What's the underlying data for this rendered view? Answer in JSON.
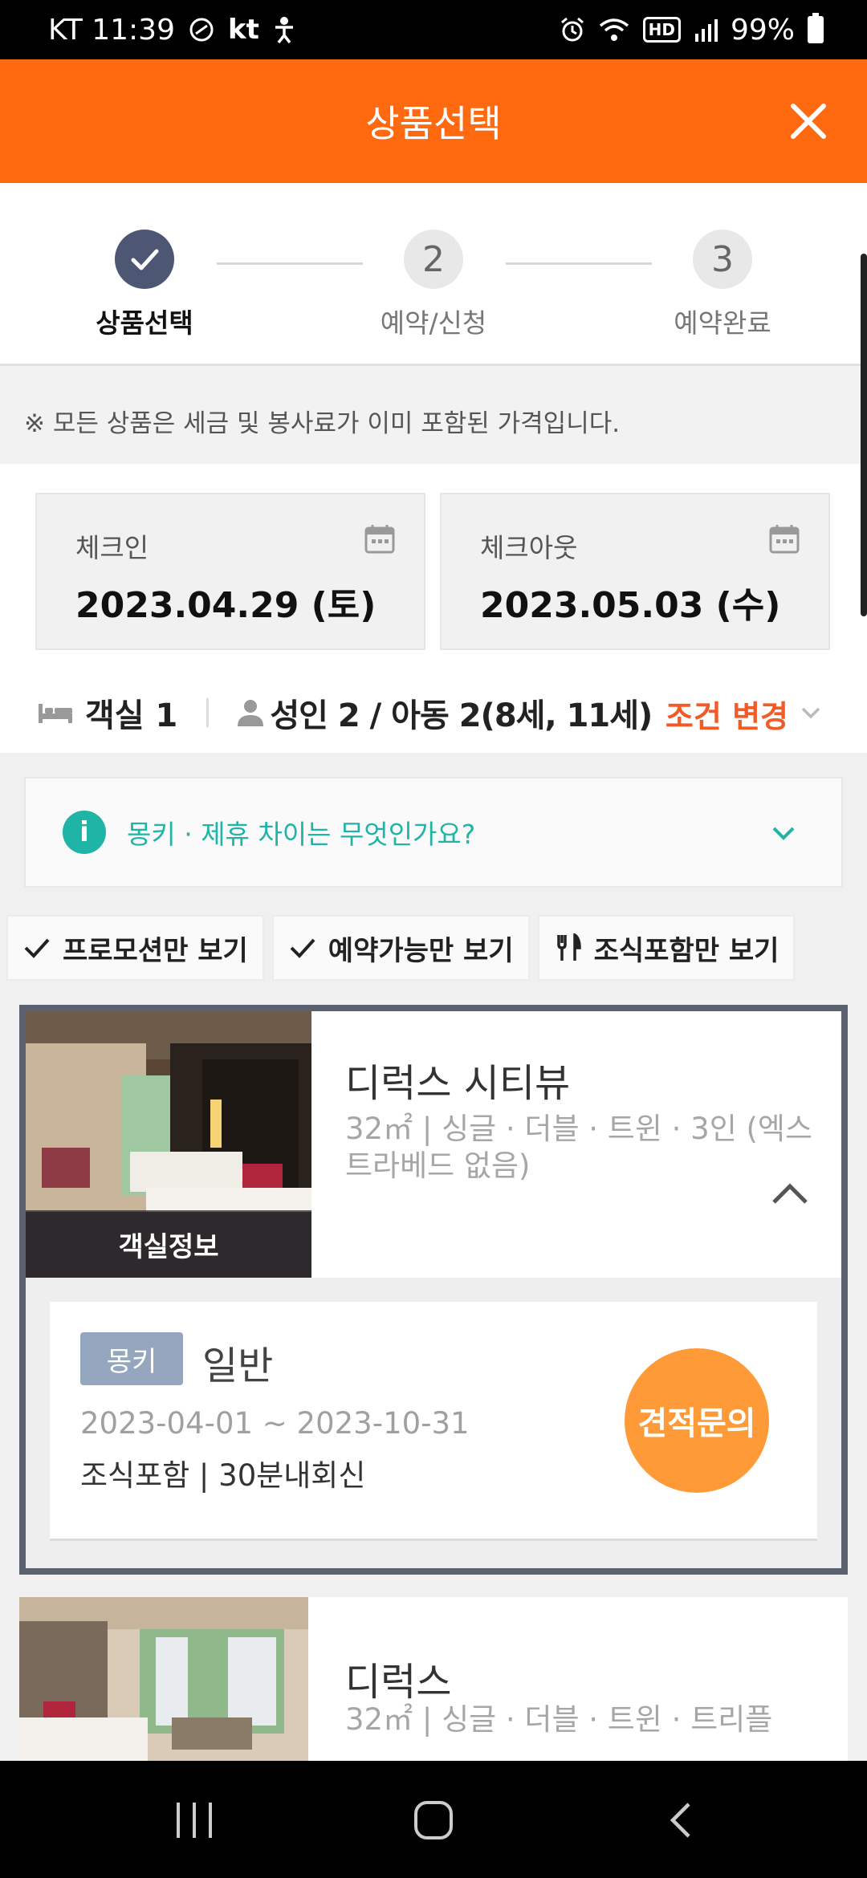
{
  "status_bar": {
    "carrier_time": "KT 11:39",
    "carrier_logo": "kt",
    "battery": "99%",
    "hd_label": "HD",
    "icons": [
      "nfc-icon",
      "kt-logo",
      "accessibility-icon",
      "alarm-icon",
      "wifi-icon",
      "hd-voice-icon",
      "signal-icon",
      "battery-icon"
    ]
  },
  "header": {
    "title": "상품선택",
    "close_icon": "close-icon"
  },
  "steps": [
    {
      "number": "1",
      "label": "상품선택",
      "state": "done"
    },
    {
      "number": "2",
      "label": "예약/신청",
      "state": "pending"
    },
    {
      "number": "3",
      "label": "예약완료",
      "state": "pending"
    }
  ],
  "notice": "※ 모든 상품은 세금 및 봉사료가 이미 포함된 가격입니다.",
  "checkin": {
    "label": "체크인",
    "value": "2023.04.29 (토)"
  },
  "checkout": {
    "label": "체크아웃",
    "value": "2023.05.03 (수)"
  },
  "condition": {
    "rooms": "객실 1",
    "guests": "성인 2 / 아동 2(8세, 11세)",
    "change_label": "조건 변경"
  },
  "faq": {
    "info_icon": "i",
    "text": "몽키 · 제휴 차이는 무엇인가요?"
  },
  "filters": [
    {
      "label": "프로모션만 보기",
      "icon": "check-icon"
    },
    {
      "label": "예약가능만 보기",
      "icon": "check-icon"
    },
    {
      "label": "조식포함만 보기",
      "icon": "utensils-icon"
    }
  ],
  "rooms": [
    {
      "name": "디럭스 시티뷰",
      "spec": "32㎡ | 싱글 · 더블 · 트윈 · 3인 (엑스트라베드 없음)",
      "image_caption": "객실정보",
      "rate": {
        "badge": "몽키",
        "name": "일반",
        "period": "2023-04-01 ~ 2023-10-31",
        "conditions": "조식포함 | 30분내회신",
        "button": "견적문의"
      }
    },
    {
      "name": "디럭스",
      "spec": "32㎡ | 싱글 · 더블 · 트윈 · 트리플"
    }
  ],
  "colors": {
    "header": "#ff6a10",
    "step_active": "#4d5672",
    "change_link": "#f25a28",
    "faq_accent": "#1fb4a6",
    "quote_button": "#ff9a38",
    "badge": "#95a7bf",
    "card_border": "#5c6170"
  }
}
